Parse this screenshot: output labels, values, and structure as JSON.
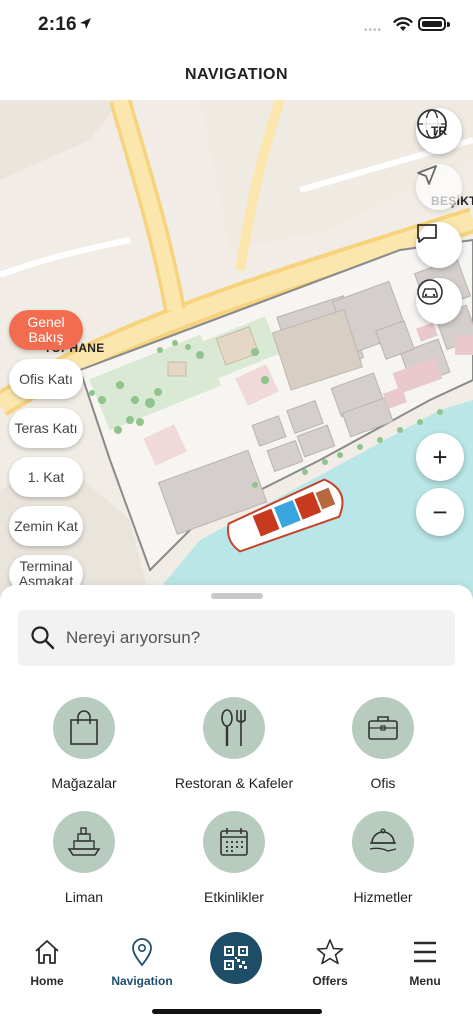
{
  "status_bar": {
    "time": "2:16",
    "signal_dots": "••••"
  },
  "header": {
    "title": "NAVIGATION"
  },
  "map": {
    "language_badge": "TR",
    "labels": {
      "besiktas": "BEŞİKTAŞ",
      "tophane": "TOPHANE"
    },
    "floors": [
      {
        "label": "Genel Bakış",
        "active": true
      },
      {
        "label": "Ofis Katı",
        "active": false
      },
      {
        "label": "Teras Katı",
        "active": false
      },
      {
        "label": "1. Kat",
        "active": false
      },
      {
        "label": "Zemin Kat",
        "active": false
      },
      {
        "label": "Terminal Asmakat",
        "active": false
      }
    ],
    "zoom_in": "+",
    "zoom_out": "−"
  },
  "search": {
    "placeholder": "Nereyi arıyorsun?"
  },
  "categories": [
    {
      "label": "Mağazalar",
      "icon": "shopping-bag-icon"
    },
    {
      "label": "Restoran & Kafeler",
      "icon": "cutlery-icon"
    },
    {
      "label": "Ofis",
      "icon": "briefcase-icon"
    },
    {
      "label": "Liman",
      "icon": "ship-icon"
    },
    {
      "label": "Etkinlikler",
      "icon": "calendar-icon"
    },
    {
      "label": "Hizmetler",
      "icon": "cloche-icon"
    }
  ],
  "tabbar": {
    "home": "Home",
    "navigation": "Navigation",
    "offers": "Offers",
    "menu": "Menu"
  },
  "colors": {
    "accent": "#1e4d68",
    "active_floor": "#f26c4f",
    "category_circle": "#b7ccbf"
  }
}
